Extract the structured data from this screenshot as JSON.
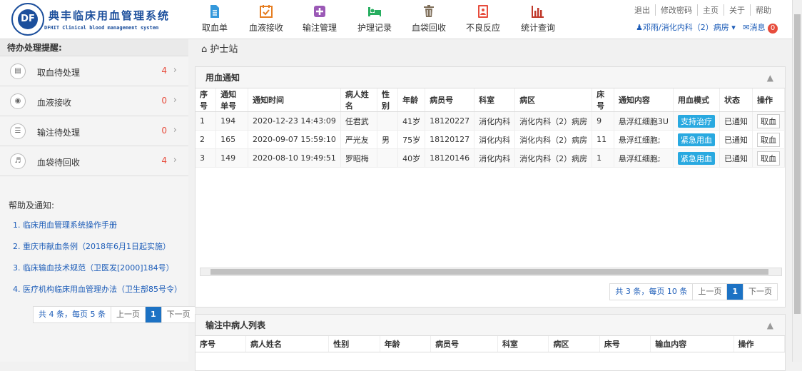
{
  "app": {
    "title": "典丰临床用血管理系统",
    "subtitle": "DFHIT Clinical blood management system",
    "logo_mark": "DF"
  },
  "nav": [
    {
      "label": "取血单",
      "icon": "document-icon",
      "color": "#3498db"
    },
    {
      "label": "血液接收",
      "icon": "calendar-check-icon",
      "color": "#e67e22"
    },
    {
      "label": "输注管理",
      "icon": "plus-square-icon",
      "color": "#9b59b6"
    },
    {
      "label": "护理记录",
      "icon": "bed-icon",
      "color": "#27ae60"
    },
    {
      "label": "血袋回收",
      "icon": "trash-icon",
      "color": "#7f6f5a"
    },
    {
      "label": "不良反应",
      "icon": "report-icon",
      "color": "#e74c3c"
    },
    {
      "label": "统计查询",
      "icon": "bar-chart-icon",
      "color": "#c0392b"
    }
  ],
  "top_links": [
    "退出",
    "修改密码",
    "主页",
    "关于",
    "帮助"
  ],
  "user": {
    "name": "邓雨/消化内科（2）病房",
    "messages_label": "消息",
    "messages_count": "0"
  },
  "sidebar": {
    "title": "待办处理提醒:",
    "todos": [
      {
        "label": "取血待处理",
        "count": "4",
        "icon": "file-icon"
      },
      {
        "label": "血液接收",
        "count": "0",
        "icon": "camera-icon"
      },
      {
        "label": "输注待处理",
        "count": "0",
        "icon": "list-icon"
      },
      {
        "label": "血袋待回收",
        "count": "4",
        "icon": "volume-icon"
      }
    ],
    "help_title": "帮助及通知:",
    "help_links": [
      "1. 临床用血管理系统操作手册",
      "2. 重庆市献血条例（2018年6月1日起实施）",
      "3. 临床输血技术规范（卫医发[2000]184号）",
      "4. 医疗机构临床用血管理办法（卫生部85号令）"
    ],
    "pager": {
      "summary": "共 4 条，每页 5 条",
      "prev": "上一页",
      "page": "1",
      "next": "下一页"
    }
  },
  "main": {
    "breadcrumb": "护士站",
    "notice_panel": {
      "title": "用血通知",
      "columns": [
        "序号",
        "通知单号",
        "通知时间",
        "病人姓名",
        "性别",
        "年龄",
        "病员号",
        "科室",
        "病区",
        "床号",
        "通知内容",
        "用血模式",
        "状态",
        "操作"
      ],
      "rows": [
        [
          "1",
          "194",
          "2020-12-23 14:43:09",
          "任君武",
          "",
          "41岁",
          "18120227",
          "消化内科",
          "消化内科（2）病房",
          "9",
          "悬浮红细胞3U",
          "支持治疗",
          "已通知",
          "取血"
        ],
        [
          "2",
          "165",
          "2020-09-07 15:59:10",
          "严光友",
          "男",
          "75岁",
          "18120127",
          "消化内科",
          "消化内科（2）病房",
          "11",
          "悬浮红细胞;",
          "紧急用血",
          "已通知",
          "取血"
        ],
        [
          "3",
          "149",
          "2020-08-10 19:49:51",
          "罗昭梅",
          "",
          "40岁",
          "18120146",
          "消化内科",
          "消化内科（2）病房",
          "1",
          "悬浮红细胞;",
          "紧急用血",
          "已通知",
          "取血"
        ]
      ],
      "pager": {
        "summary": "共 3 条，每页 10 条",
        "prev": "上一页",
        "page": "1",
        "next": "下一页"
      }
    },
    "infusion_panel": {
      "title": "输注中病人列表",
      "columns": [
        "序号",
        "病人姓名",
        "性别",
        "年龄",
        "病员号",
        "科室",
        "病区",
        "床号",
        "输血内容",
        "操作"
      ]
    }
  },
  "colors": {
    "accent": "#1c72c4",
    "brand": "#1c4f9c",
    "mode_badge": "#29a9e0",
    "alert": "#e74c3c"
  }
}
